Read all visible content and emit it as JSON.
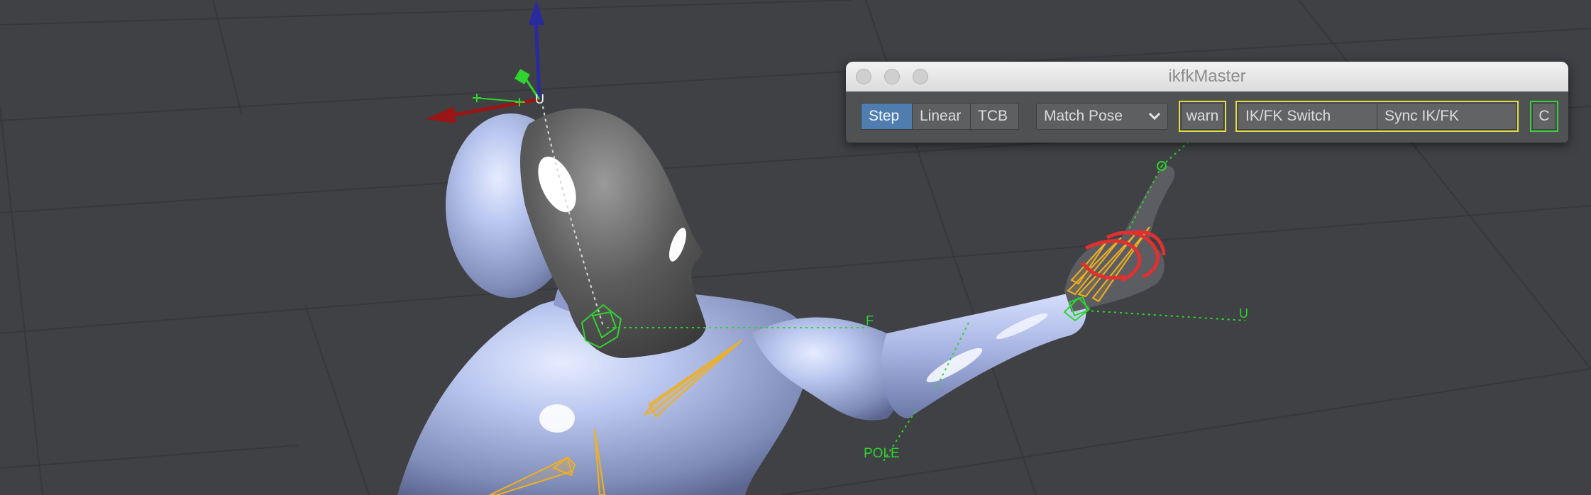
{
  "window": {
    "title": "ikfkMaster"
  },
  "toolbar": {
    "tangent_modes": [
      {
        "label": "Step",
        "active": true
      },
      {
        "label": "Linear",
        "active": false
      },
      {
        "label": "TCB",
        "active": false
      }
    ],
    "match_mode": {
      "selected": "Match Pose"
    },
    "warn_label": "warn",
    "ik_fk_switch_label": "IK/FK Switch",
    "sync_label": "Sync IK/FK",
    "c_label": "C"
  },
  "viewport": {
    "labels": {
      "head_up": "U",
      "forward": "F",
      "hand_up": "U",
      "pole": "POLE"
    }
  },
  "colors": {
    "viewport_bg": "#3f4144",
    "accent_active": "#4f7db0",
    "highlight_yellow": "#e1dc3f",
    "highlight_green": "#35d23a",
    "control_green": "#2fd42f",
    "joint_yellow": "#f0b020",
    "control_red": "#e03030"
  },
  "icons": {
    "dropdown": "chevron-down-icon",
    "window_controls": [
      "close-icon",
      "minimize-icon",
      "zoom-icon"
    ],
    "gizmo": "transform-gizmo-icon"
  }
}
